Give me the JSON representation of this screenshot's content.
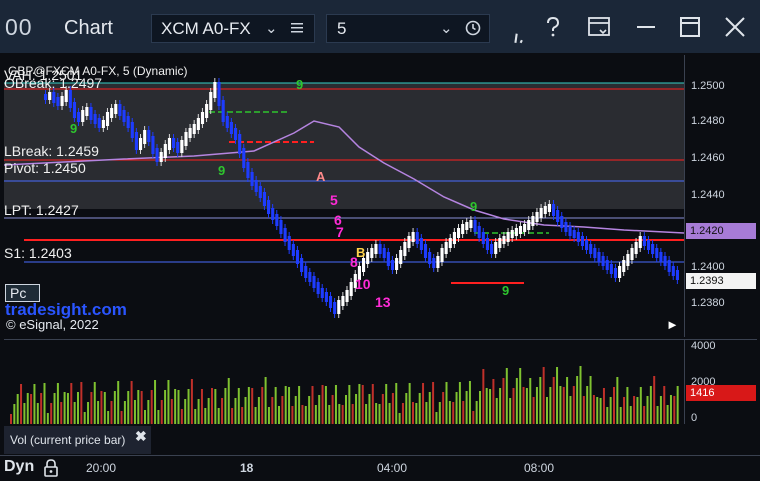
{
  "titlebar": {
    "logo": "00",
    "title": "Chart",
    "symbol": "XCM A0-FX",
    "interval": "5"
  },
  "chart": {
    "header": "GBP@FXCM A0-FX, 5 (Dynamic)",
    "levels": {
      "vah": "VAH: 1.2501",
      "obreak": "OBreak: 1.2497",
      "lbreak": "LBreak: 1.2459",
      "pivot": "Pivot: 1.2450",
      "lpt": "LPT: 1.2427",
      "s1": "S1: 1.2403"
    },
    "pc_button": "Pc",
    "watermark": "tradesight.com",
    "copyright": "© eSignal, 2022",
    "markers": {
      "a": "A",
      "b": "B",
      "n5": "5",
      "n6": "6",
      "n7": "7",
      "n8": "8",
      "n10": "10",
      "n13": "13",
      "n9a": "9",
      "n9b": "9",
      "n9c": "9",
      "n9d": "9",
      "n9e": "9"
    }
  },
  "price_axis": {
    "ticks": [
      "1.2500",
      "1.2480",
      "1.2460",
      "1.2440",
      "1.2420",
      "1.2400",
      "1.2380"
    ],
    "tag_current": "1.2420",
    "tag_last": "1.2393"
  },
  "volume": {
    "label": "Vol (current price bar)",
    "ticks": [
      "4000",
      "2000",
      "0"
    ],
    "current": "1416"
  },
  "time_axis": {
    "labels": [
      "20:00",
      "18",
      "04:00",
      "08:00"
    ],
    "mode": "Dyn"
  },
  "colors": {
    "up_candle": "#ffffff",
    "down_candle": "#1e3cff",
    "level_red": "#ff2020",
    "pivot_blue": "#4a6cff",
    "ma_purple": "#b584e0",
    "marker_magenta": "#ff2bd6",
    "marker_green": "#2ec42e",
    "volume_up": "#7fc230",
    "volume_down": "#c0302a"
  }
}
